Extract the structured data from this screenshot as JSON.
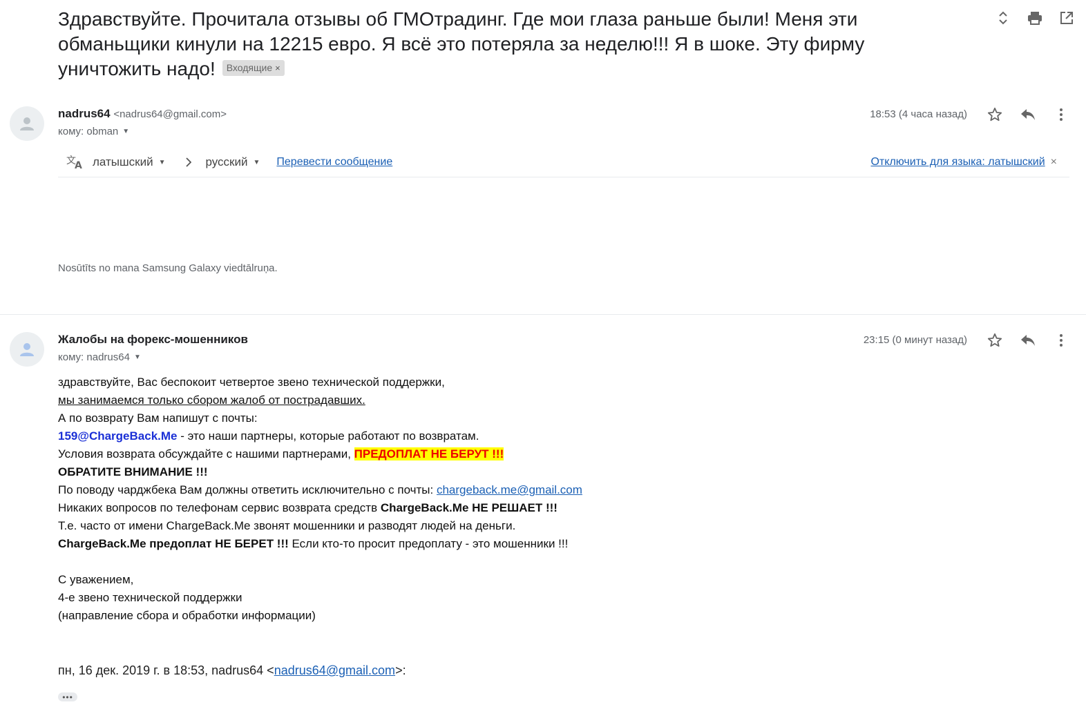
{
  "thread": {
    "subject": "Здравствуйте. Прочитала отзывы об ГМОтрадинг. Где мои глаза раньше были! Меня эти обманьщики кинули на 12215 евро. Я всё это потеряла за неделю!!! Я в шоке. Эту фирму уничтожить надо!",
    "label": "Входящие",
    "label_close": "×",
    "actions": [
      "expand-all-icon",
      "print-icon",
      "open-in-new-window-icon"
    ]
  },
  "message1": {
    "sender_name": "nadrus64",
    "sender_email": "<nadrus64@gmail.com>",
    "to": "кому: obman",
    "time": "18:53 (4 часа назад)",
    "translate": {
      "from_lang": "латышский",
      "to_lang": "русский",
      "translate_link": "Перевести сообщение",
      "disable_link": "Отключить для языка: латышский",
      "close": "×"
    },
    "signature": "Nosūtīts no mana Samsung Galaxy viedtālruņa."
  },
  "message2": {
    "sender_name": "Жалобы на форекс-мошенников",
    "to": "кому: nadrus64",
    "time": "23:15 (0 минут назад)",
    "body": {
      "l1": "здравствуйте, Вас беспокоит четвертое звено технической поддержки,",
      "l2": "мы занимаемся только сбором жалоб от пострадавших.",
      "l3": "А по возврату Вам напишут с почты:",
      "l4_email": "159@ChargeBack.Me",
      "l4_rest": " - это наши партнеры, которые работают по возвратам.",
      "l5_a": "Условия возврата обсуждайте с нашими партнерами, ",
      "l5_hl": "ПРЕДОПЛАТ НЕ БЕРУТ !!!",
      "l6": "ОБРАТИТЕ ВНИМАНИЕ !!!",
      "l7_a": "По поводу чарджбека Вам должны ответить исключительно с почты: ",
      "l7_link": "chargeback.me@gmail.com",
      "l8_a": "Никаких вопросов по телефонам сервис возврата средств ",
      "l8_b": "ChargeBack.Me НЕ РЕШАЕТ !!!",
      "l9": "Т.е. часто от имени ChargeBack.Me звонят мошенники и разводят людей на деньги.",
      "l10_b": "ChargeBack.Me предоплат НЕ БЕРЕТ !!!",
      "l10_a": " Если кто-то просит предоплату - это мошенники !!!",
      "sign1": "С уважением,",
      "sign2": "4-е звено технической поддержки",
      "sign3": "(направление сбора и обработки информации)"
    },
    "quote_prefix": "пн, 16 дек. 2019 г. в 18:53, nadrus64 <",
    "quote_email": "nadrus64@gmail.com",
    "quote_suffix": ">:",
    "ellipsis": "•••"
  },
  "colors": {
    "link": "#1a5fb4",
    "email_blue": "#1a2fd6",
    "highlight_bg": "#ffff00",
    "highlight_fg": "#ee0000"
  }
}
